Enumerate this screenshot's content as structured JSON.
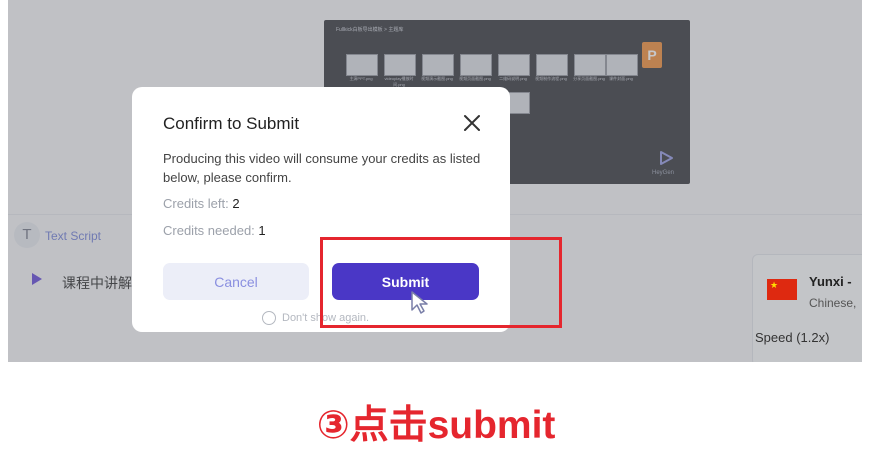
{
  "background": {
    "video_window_title": "Fullkick白板导出模板 > 主题库",
    "thumbnails": [
      "主演PPT.png",
      "videoplay播放时间.png",
      "视频演示截图.png",
      "视频页面截图.png",
      "二维码说明.png",
      "视频制作流程.png",
      "分享页面截图.png",
      "课件封面.png"
    ],
    "watermark_brand": "HeyGen",
    "tab_text_script": "Text Script",
    "tab_icon": "T",
    "script_line": "课程中讲解",
    "voice_name": "Yunxi -",
    "voice_language": "Chinese,",
    "speed_label": "Speed (1.2x)"
  },
  "modal": {
    "title": "Confirm to Submit",
    "description": "Producing this video will consume your credits as listed below, please confirm.",
    "credits_left_label": "Credits left:",
    "credits_left_value": "2",
    "credits_needed_label": "Credits needed:",
    "credits_needed_value": "1",
    "cancel_label": "Cancel",
    "submit_label": "Submit",
    "dont_show_label": "Don't show again."
  },
  "caption": "③点击submit",
  "colors": {
    "accent": "#4a37c6",
    "highlight": "#e5262e",
    "cancel_bg": "#eceef8"
  }
}
